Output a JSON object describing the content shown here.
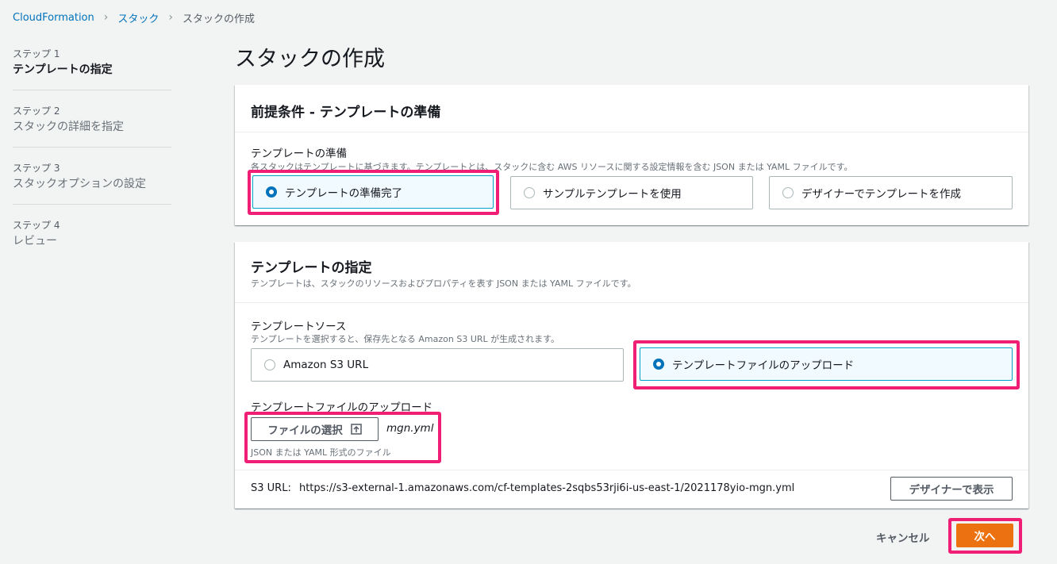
{
  "breadcrumb": {
    "items": [
      "CloudFormation",
      "スタック",
      "スタックの作成"
    ]
  },
  "sidebar": {
    "steps": [
      {
        "num": "ステップ 1",
        "title": "テンプレートの指定"
      },
      {
        "num": "ステップ 2",
        "title": "スタックの詳細を指定"
      },
      {
        "num": "ステップ 3",
        "title": "スタックオプションの設定"
      },
      {
        "num": "ステップ 4",
        "title": "レビュー"
      }
    ]
  },
  "page": {
    "title": "スタックの作成"
  },
  "prereq": {
    "title": "前提条件 - テンプレートの準備",
    "label": "テンプレートの準備",
    "desc": "各スタックはテンプレートに基づきます。テンプレートとは、スタックに含む AWS リソースに関する設定情報を含む JSON または YAML ファイルです。",
    "options": [
      "テンプレートの準備完了",
      "サンプルテンプレートを使用",
      "デザイナーでテンプレートを作成"
    ],
    "selected": "テンプレートの準備完了"
  },
  "spec": {
    "title": "テンプレートの指定",
    "desc": "テンプレートは、スタックのリソースおよびプロパティを表す JSON または YAML ファイルです。",
    "source_label": "テンプレートソース",
    "source_desc": "テンプレートを選択すると、保存先となる Amazon S3 URL が生成されます。",
    "source_options": [
      "Amazon S3 URL",
      "テンプレートファイルのアップロード"
    ],
    "source_selected": "テンプレートファイルのアップロード",
    "upload_label": "テンプレートファイルのアップロード",
    "choose_file_label": "ファイルの選択",
    "file_name": "mgn.yml",
    "file_hint": "JSON または YAML 形式のファイル",
    "s3_url_label": "S3 URL:",
    "s3_url": "https://s3-external-1.amazonaws.com/cf-templates-2sqbs53rji6i-us-east-1/2021178yio-mgn.yml",
    "designer_button": "デザイナーで表示"
  },
  "footer": {
    "cancel": "キャンセル",
    "next": "次へ"
  },
  "colors": {
    "accent": "#0073bb",
    "primary_button": "#ec7211",
    "highlight": "#f01f75"
  }
}
